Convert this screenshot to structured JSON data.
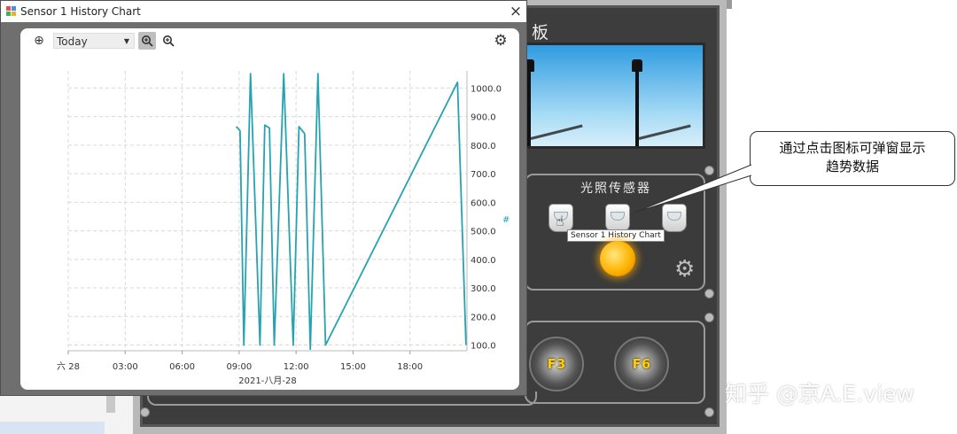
{
  "dialog": {
    "title": "Sensor 1 History Chart",
    "close": "×",
    "toolbar": {
      "range_value": "Today",
      "icons": [
        "add-circle-icon",
        "zoom-in-icon",
        "zoom-out-icon",
        "settings-gear-icon"
      ]
    }
  },
  "chart_data": {
    "type": "line",
    "x_label": "2021-八月-28",
    "x_ticks": [
      "六 28",
      "03:00",
      "06:00",
      "09:00",
      "12:00",
      "15:00",
      "18:00"
    ],
    "y_ticks": [
      "100.0",
      "200.0",
      "300.0",
      "400.0",
      "500.0",
      "600.0",
      "700.0",
      "800.0",
      "900.0",
      "1000.0"
    ],
    "y_axis_marker": "#",
    "grid": true,
    "ylim": [
      80,
      1060
    ],
    "x_range_hours": [
      0,
      21
    ],
    "color": "#26a3b0",
    "points": [
      [
        8.85,
        865
      ],
      [
        9.05,
        850
      ],
      [
        9.25,
        100
      ],
      [
        9.6,
        1050
      ],
      [
        10.1,
        100
      ],
      [
        10.35,
        870
      ],
      [
        10.6,
        860
      ],
      [
        10.85,
        100
      ],
      [
        11.35,
        1050
      ],
      [
        11.85,
        100
      ],
      [
        12.15,
        865
      ],
      [
        12.45,
        840
      ],
      [
        12.75,
        85
      ],
      [
        13.15,
        1050
      ],
      [
        13.55,
        100
      ],
      [
        20.5,
        1020
      ],
      [
        20.95,
        100
      ]
    ]
  },
  "panel": {
    "title_fragment": "板",
    "light_sensor_title": "光照传感器",
    "tooltip": "Sensor 1 History Chart",
    "badges": [
      "F3",
      "F6"
    ]
  },
  "callout": {
    "line1": "通过点击图标可弹窗显示",
    "line2": "趋势数据"
  },
  "watermark": "知乎 @京A.E.view",
  "colors": {
    "series": "#26a3b0",
    "dialog_frame": "#6f6f6f",
    "panel_dark": "#3d3d3d"
  }
}
